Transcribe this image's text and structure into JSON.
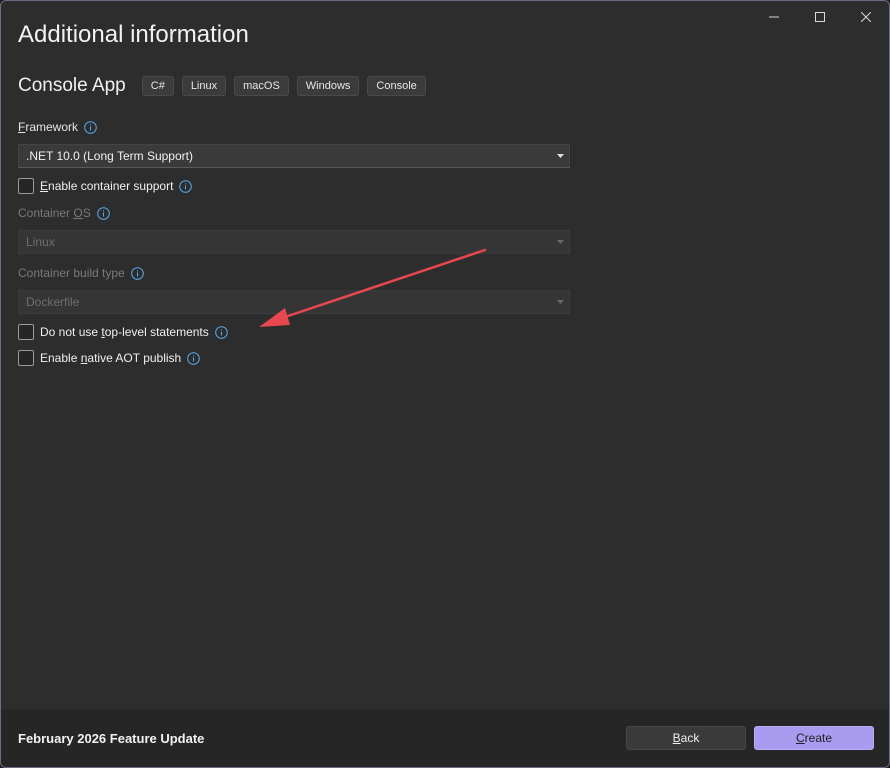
{
  "dialog": {
    "title": "Additional information",
    "window_controls": [
      "minimize-icon",
      "maximize-icon",
      "close-icon"
    ]
  },
  "template": {
    "name": "Console App",
    "tags": [
      "C#",
      "Linux",
      "macOS",
      "Windows",
      "Console"
    ]
  },
  "framework": {
    "label_prefix": "",
    "label_access": "F",
    "label_rest": "ramework",
    "value": ".NET 10.0 (Long Term Support)"
  },
  "container_support": {
    "label_access": "E",
    "label_rest": "nable container support",
    "checked": false
  },
  "container_os": {
    "label_prefix": "Container ",
    "label_access": "O",
    "label_rest": "S",
    "value": "Linux"
  },
  "container_build_type": {
    "label": "Container build type",
    "value": "Dockerfile"
  },
  "top_level_statements": {
    "label_prefix": "Do not use ",
    "label_access": "t",
    "label_rest": "op-level statements",
    "checked": false
  },
  "native_aot": {
    "label_prefix": "Enable ",
    "label_access": "n",
    "label_rest": "ative AOT publish",
    "checked": false
  },
  "footer": {
    "text": "February 2026 Feature Update",
    "back_access": "B",
    "back_rest": "ack",
    "create_access": "C",
    "create_rest": "reate"
  },
  "colors": {
    "accent": "#a99cf0",
    "annotation_arrow": "#e8474f",
    "info_icon": "#5aa8e6"
  }
}
